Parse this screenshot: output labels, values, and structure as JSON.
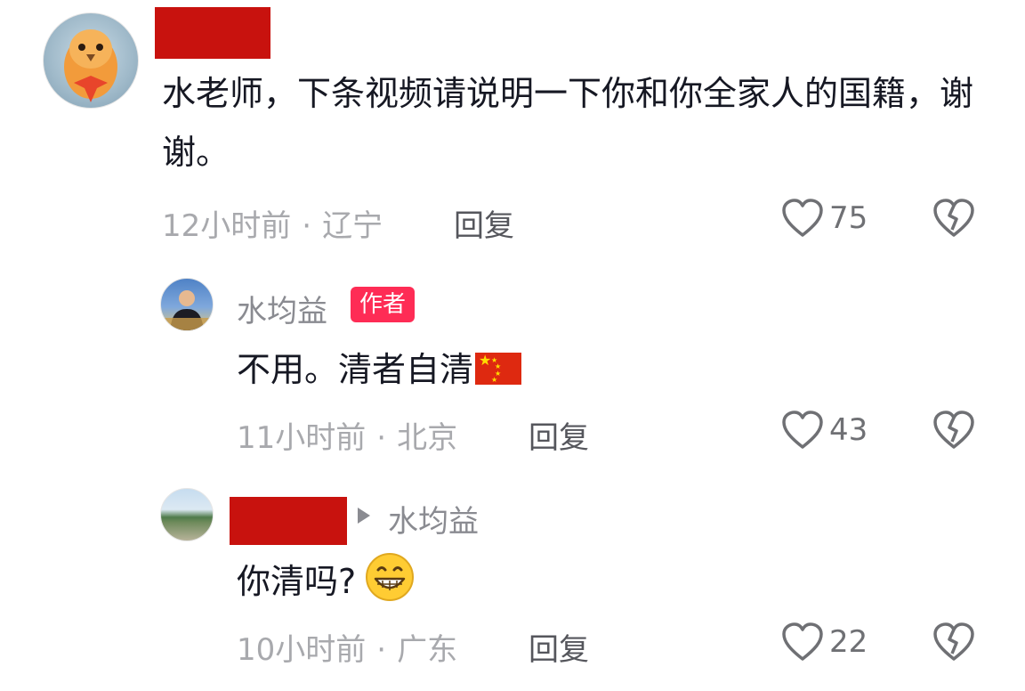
{
  "comments": [
    {
      "text": "水老师，下条视频请说明一下你和你全家人的国籍，谢谢。",
      "time": "12小时前",
      "location": "辽宁",
      "reply_label": "回复",
      "likes": "75",
      "username_redacted": true
    },
    {
      "name": "水均益",
      "badge": "作者",
      "text": "不用。清者自清",
      "emoji": "china-flag",
      "time": "11小时前",
      "location": "北京",
      "reply_label": "回复",
      "likes": "43"
    },
    {
      "reply_to": "水均益",
      "text": "你清吗?",
      "emoji": "grinning-face",
      "time": "10小时前",
      "location": "广东",
      "reply_label": "回复",
      "likes": "22",
      "username_redacted": true
    }
  ],
  "meta_separator": "·",
  "icons": {
    "like": "heart-outline-icon",
    "dislike": "broken-heart-icon"
  },
  "colors": {
    "redaction": "#c8120e",
    "author_badge": "#fe2c55",
    "meta_text": "#a8a9ad"
  }
}
